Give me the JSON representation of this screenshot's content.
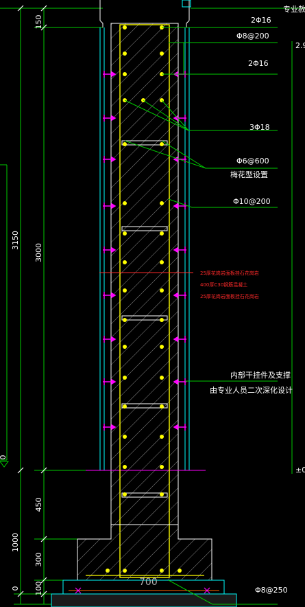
{
  "dimensions": {
    "d150": "150",
    "d3150": "3150",
    "d3000": "3000",
    "d450": "450",
    "d1000": "1000",
    "d300": "300",
    "d100": "100",
    "d0": "0",
    "d700": "700"
  },
  "labels": {
    "top_right": "专业赦",
    "rebar_2phi16_top": "2Φ16",
    "stirrup_phi8_200": "Φ8@200",
    "rebar_2phi16_mid": "2Φ16",
    "rebar_3phi18": "3Φ18",
    "tie_phi6_600": "Φ6@600",
    "tie_pattern": "梅花型设置",
    "phi10_200": "Φ10@200",
    "hanger_line1": "内部干挂件及支撑",
    "hanger_line2": "由专业人员二次深化设计",
    "base_phi8_250": "Φ8@250",
    "right_edge_top": "2.9",
    "right_edge_bottom": "±0"
  },
  "red_notes": [
    "25厚花岗岩面板挂石花岗岩",
    "400厚C30钢筋混凝土",
    "25厚花岗岩面板挂石花岗岩"
  ],
  "colors": {
    "background": "#000000",
    "dimension": "#00ff00",
    "leader": "#00ff00",
    "cladding": "#00ffff",
    "column_outline": "#ffffff",
    "rebar": "#ffff00",
    "anchor": "#ff00ff",
    "note_red": "#ff2a2a",
    "hatch": "#9a9a9a"
  }
}
